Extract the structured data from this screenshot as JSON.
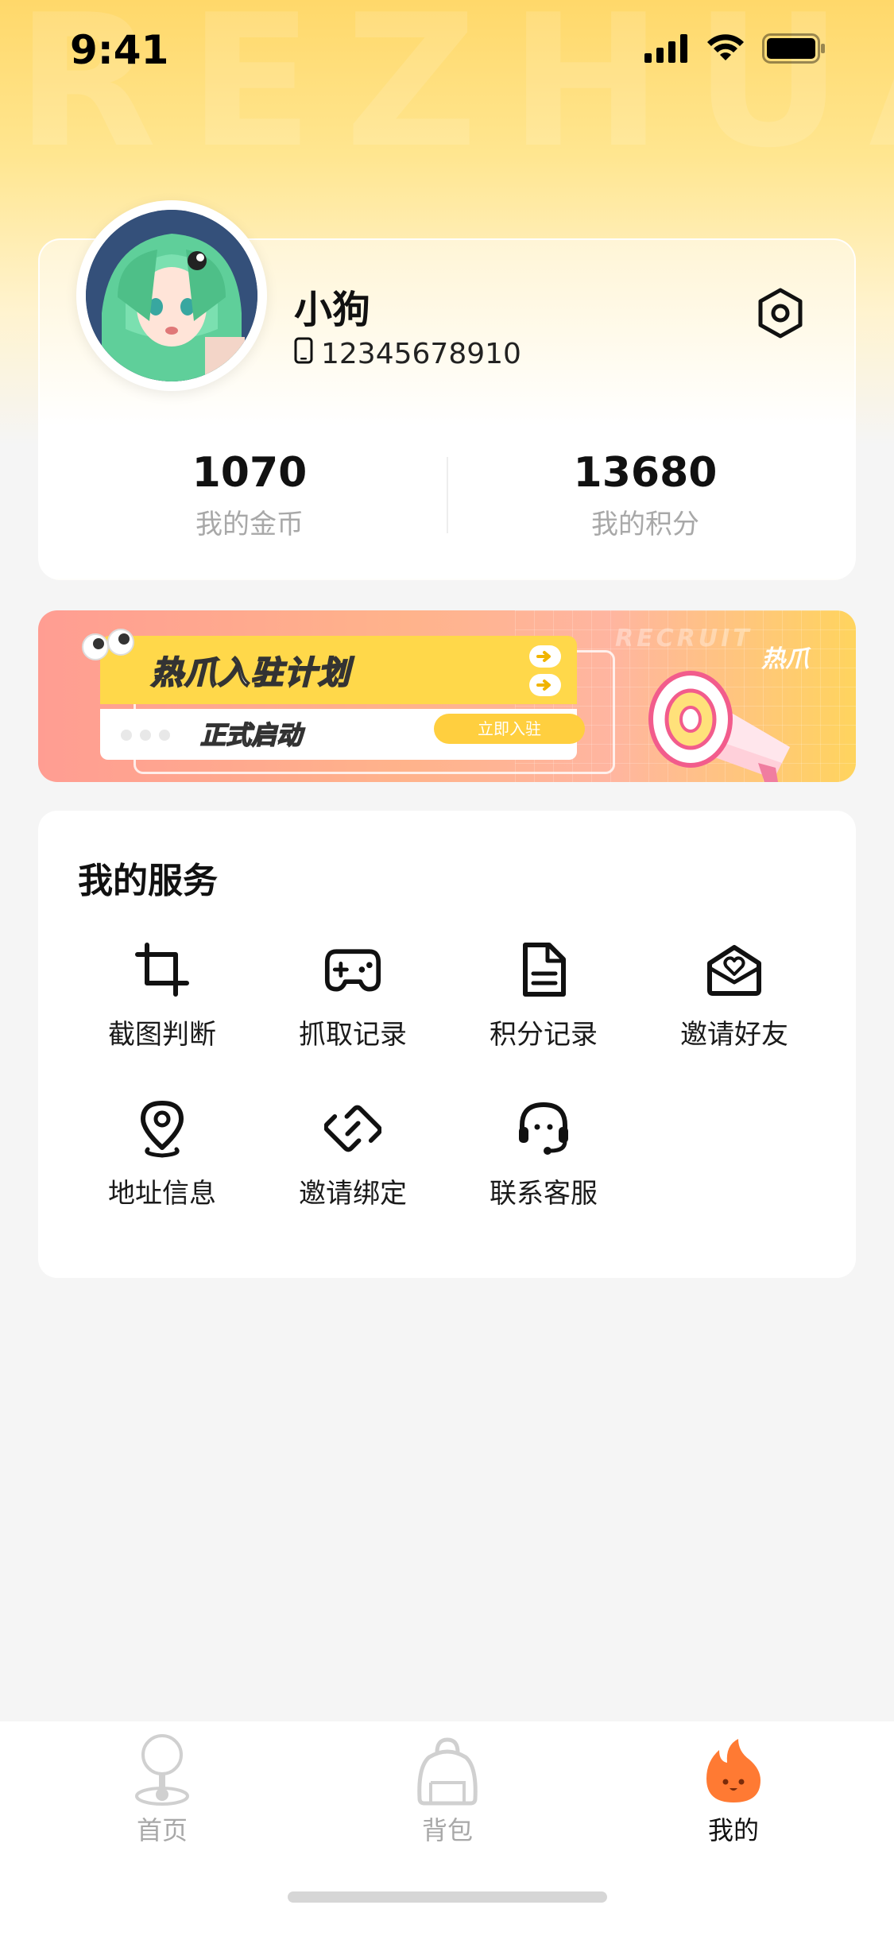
{
  "status_bar": {
    "time": "9:41"
  },
  "profile": {
    "username": "小狗",
    "phone": "12345678910",
    "stats": [
      {
        "value": "1070",
        "label": "我的金币"
      },
      {
        "value": "13680",
        "label": "我的积分"
      }
    ]
  },
  "banner": {
    "title": "热爪入驻计划",
    "subtitle": "正式启动",
    "cta": "立即入驻",
    "recruit": "RECRUIT",
    "brand": "热爪"
  },
  "services": {
    "title": "我的服务",
    "items": [
      {
        "label": "截图判断",
        "icon": "crop-icon"
      },
      {
        "label": "抓取记录",
        "icon": "gamepad-icon"
      },
      {
        "label": "积分记录",
        "icon": "document-icon"
      },
      {
        "label": "邀请好友",
        "icon": "heart-envelope-icon"
      },
      {
        "label": "地址信息",
        "icon": "location-pin-icon"
      },
      {
        "label": "邀请绑定",
        "icon": "link-icon"
      },
      {
        "label": "联系客服",
        "icon": "headset-icon"
      }
    ]
  },
  "tabbar": {
    "tabs": [
      {
        "label": "首页",
        "icon": "joystick-icon",
        "active": false
      },
      {
        "label": "背包",
        "icon": "backpack-icon",
        "active": false
      },
      {
        "label": "我的",
        "icon": "flame-icon",
        "active": true
      }
    ]
  },
  "colors": {
    "accent": "#ff7a33",
    "top_gradient": "#ffd86a",
    "muted_text": "#a8a8a8"
  }
}
